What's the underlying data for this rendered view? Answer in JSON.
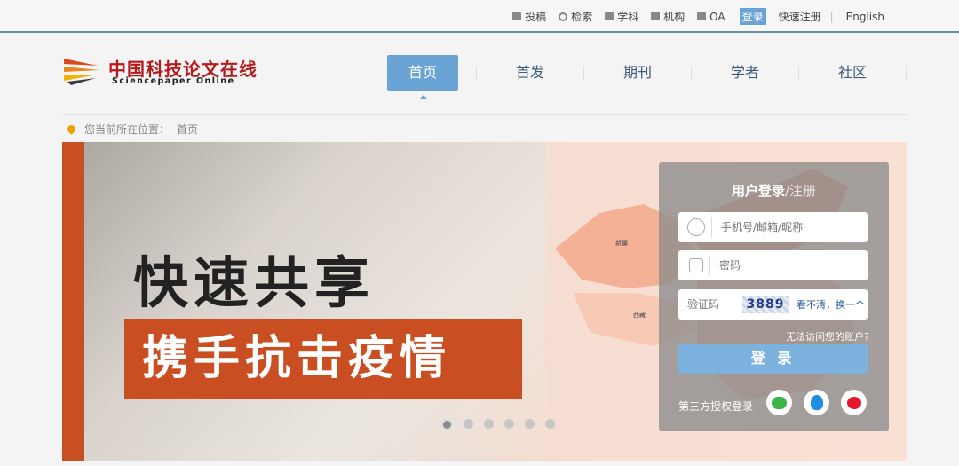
{
  "topnav": {
    "items": [
      {
        "icon": "mail-icon",
        "label": "投稿"
      },
      {
        "icon": "search-icon",
        "label": "检索"
      },
      {
        "icon": "book-icon",
        "label": "学科"
      },
      {
        "icon": "building-icon",
        "label": "机构"
      },
      {
        "icon": "monitor-icon",
        "label": "OA"
      }
    ],
    "login": "登录",
    "register": "快速注册",
    "english": "English"
  },
  "header": {
    "logo_cn": "中国科技论文在线",
    "logo_en": "Sciencepaper Online",
    "tabs": [
      "首页",
      "首发",
      "期刊",
      "学者",
      "社区"
    ],
    "active_tab": 0
  },
  "breadcrumb": {
    "prefix": "您当前所在位置：",
    "current": "首页"
  },
  "banner": {
    "headline": "快速共享",
    "slogan": "携手抗击疫情",
    "slide_count": 6,
    "active_slide": 0,
    "map_labels": [
      "新疆",
      "西藏"
    ]
  },
  "login_panel": {
    "title": "用户登录",
    "register_link": "/注册",
    "username_placeholder": "手机号/邮箱/昵称",
    "password_placeholder": "密码",
    "captcha_placeholder": "验证码",
    "captcha_text": "3889",
    "refresh_text": "看不清，换一个",
    "forgot_text": "无法访问您的账户?",
    "submit_label": "登 录",
    "third_party_label": "第三方授权登录",
    "third_party": [
      "wechat-icon",
      "qq-icon",
      "weibo-icon"
    ]
  },
  "colors": {
    "accent": "#6aa4d4",
    "brand_red": "#b7181c",
    "banner_orange": "#c94f22"
  }
}
